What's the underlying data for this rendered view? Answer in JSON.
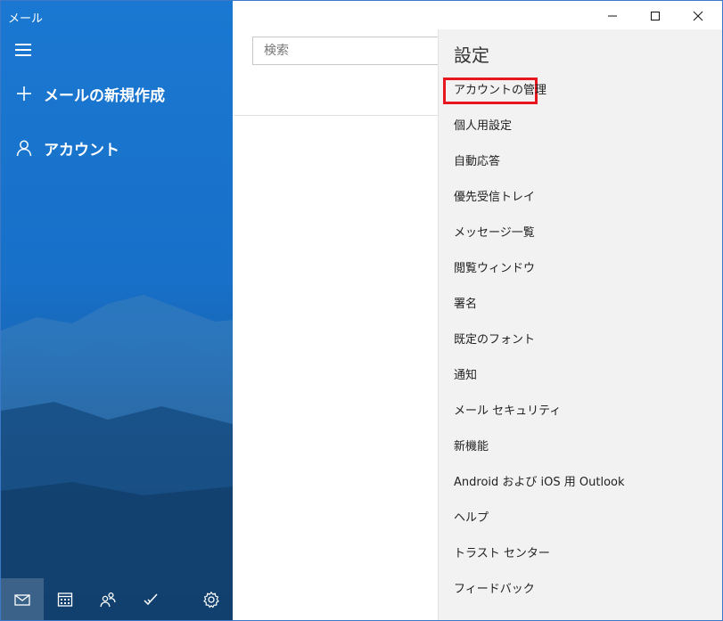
{
  "app": {
    "title": "メール"
  },
  "nav": {
    "menu_icon": "hamburger-icon",
    "new_mail_label": "メールの新規作成",
    "accounts_label": "アカウント"
  },
  "bottom_bar": {
    "items": [
      {
        "icon": "mail-icon",
        "active": true
      },
      {
        "icon": "calendar-icon",
        "active": false
      },
      {
        "icon": "people-icon",
        "active": false
      },
      {
        "icon": "todo-icon",
        "active": false
      },
      {
        "icon": "gear-icon",
        "active": false
      }
    ]
  },
  "search": {
    "placeholder": "検索"
  },
  "settings": {
    "title": "設定",
    "items": [
      "アカウントの管理",
      "個人用設定",
      "自動応答",
      "優先受信トレイ",
      "メッセージ一覧",
      "閲覧ウィンドウ",
      "署名",
      "既定のフォント",
      "通知",
      "メール セキュリティ",
      "新機能",
      "Android および iOS 用 Outlook",
      "ヘルプ",
      "トラスト センター",
      "フィードバック"
    ],
    "highlighted_index": 0,
    "highlight_color": "#e8161f"
  },
  "colors": {
    "nav_background": "#1a78d2",
    "settings_background": "#f2f2f2"
  }
}
